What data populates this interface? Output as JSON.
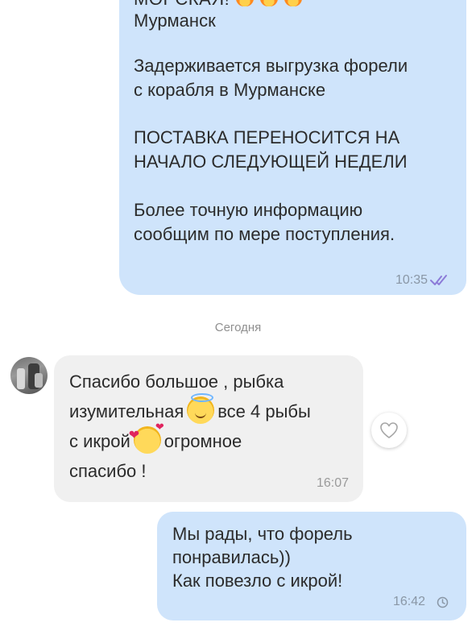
{
  "colors": {
    "outgoing_bubble": "#cfe4fb",
    "incoming_bubble": "#f0f0f0",
    "read_ticks": "#8c7bd8",
    "meta_text": "#8a97a6"
  },
  "messages": [
    {
      "direction": "outgoing",
      "lines": {
        "title_partial": "МОРСКАЯ!",
        "title_emoji": [
          "fire-emoji",
          "fire-emoji",
          "fire-emoji"
        ],
        "city": "Мурманск",
        "para1": [
          "Задерживается выгрузка форели",
          "с корабля в Мурманске"
        ],
        "para2": [
          "ПОСТАВКА ПЕРЕНОСИТСЯ НА",
          "НАЧАЛО СЛЕДУЮЩЕЙ НЕДЕЛИ"
        ],
        "para3": [
          "Более точную информацию",
          "сообщим по мере поступления."
        ]
      },
      "time": "10:35",
      "status_icon": "double-check-icon"
    },
    {
      "direction": "incoming",
      "avatar_icon": "avatar",
      "lines": {
        "l1": "Спасибо большое , рыбка",
        "l2a": "изумительная",
        "l2_emoji": "smiling-face-with-halo-emoji",
        "l2b": "все 4 рыбы",
        "l3a": "с икрой",
        "l3_emoji": "smiling-face-with-hearts-emoji",
        "l3b": "огромное",
        "l4": "спасибо !"
      },
      "time": "16:07",
      "reaction_icon": "heart-outline-icon"
    },
    {
      "direction": "outgoing",
      "lines": [
        "Мы рады, что форель",
        "понравилась))",
        "Как повезло с икрой!"
      ],
      "time": "16:42",
      "status_icon": "clock-icon"
    }
  ],
  "date_separator": "Сегодня"
}
